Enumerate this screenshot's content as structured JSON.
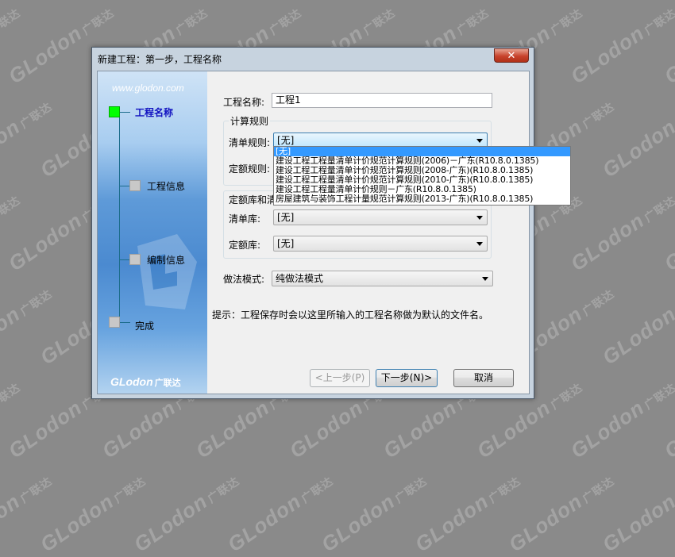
{
  "watermark": {
    "brand": "GLodon",
    "cn": "广联达"
  },
  "window": {
    "title": "新建工程：第一步，工程名称",
    "close_label": "✕"
  },
  "sidebar": {
    "url": "www.glodon.com",
    "steps": [
      {
        "label": "工程名称",
        "active": true
      },
      {
        "label": "工程信息",
        "active": false
      },
      {
        "label": "编制信息",
        "active": false
      },
      {
        "label": "完成",
        "active": false
      }
    ],
    "logo": {
      "brand": "GLodon",
      "cn": "广联达"
    }
  },
  "form": {
    "project_name_label": "工程名称:",
    "project_name_value": "工程1",
    "calc_rules_group_title": "计算规则",
    "bill_rule_label": "清单规则:",
    "bill_rule_value": "[无]",
    "quota_rule_label": "定额规则:",
    "lib_group_title": "定额库和清",
    "bill_lib_label": "清单库:",
    "bill_lib_value": "[无]",
    "quota_lib_label": "定额库:",
    "quota_lib_value": "[无]",
    "method_label": "做法模式:",
    "method_value": "纯做法模式",
    "hint": "提示：工程保存时会以这里所输入的工程名称做为默认的文件名。"
  },
  "dropdown": {
    "items": [
      "[无]",
      "建设工程工程量清单计价规范计算规则(2006)－广东(R10.8.0.1385)",
      "建设工程工程量清单计价规范计算规则(2008-广东)(R10.8.0.1385)",
      "建设工程工程量清单计价规范计算规则(2010-广东)(R10.8.0.1385)",
      "建设工程工程量清单计价规则－广东(R10.8.0.1385)",
      "房屋建筑与装饰工程计量规范计算规则(2013-广东)(R10.8.0.1385)"
    ],
    "selected_index": 0
  },
  "buttons": {
    "prev": "<上一步(P)",
    "next": "下一步(N)>",
    "cancel": "取消"
  }
}
